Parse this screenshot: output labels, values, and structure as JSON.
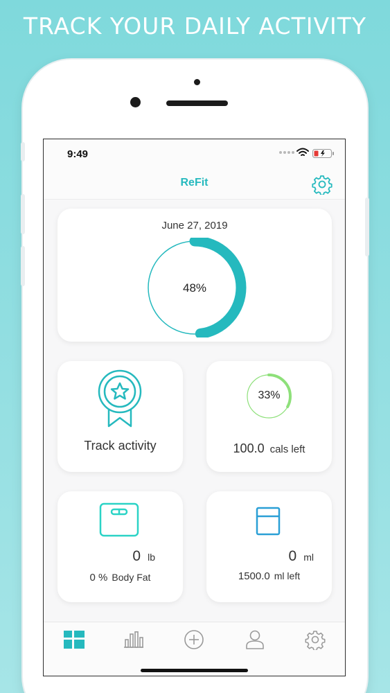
{
  "promo": {
    "headline": "TRACK YOUR DAILY ACTIVITY"
  },
  "status_bar": {
    "time": "9:49"
  },
  "nav": {
    "title": "ReFit",
    "settings_icon": "gear-icon"
  },
  "summary": {
    "date": "June 27, 2019",
    "progress_percent": 48,
    "progress_label": "48%"
  },
  "activity_card": {
    "icon": "award-ribbon-icon",
    "label": "Track activity"
  },
  "calories_card": {
    "progress_percent": 33,
    "progress_label": "33%",
    "value": "100.0",
    "unit": "cals left"
  },
  "weight_card": {
    "icon": "scale-icon",
    "value": "0",
    "unit": "lb",
    "body_fat_value": "0 %",
    "body_fat_label": "Body Fat"
  },
  "water_card": {
    "icon": "glass-icon",
    "value": "0",
    "unit": "ml",
    "left_value": "1500.0",
    "left_label": "ml left"
  },
  "tab_bar": {
    "tabs": [
      {
        "icon": "dashboard-icon",
        "active": true
      },
      {
        "icon": "bar-chart-icon",
        "active": false
      },
      {
        "icon": "plus-circle-icon",
        "active": false
      },
      {
        "icon": "user-icon",
        "active": false
      },
      {
        "icon": "gear-icon",
        "active": false
      }
    ]
  },
  "colors": {
    "accent": "#25b9be",
    "calorie_green": "#8ee07a",
    "background": "#8edde0"
  }
}
